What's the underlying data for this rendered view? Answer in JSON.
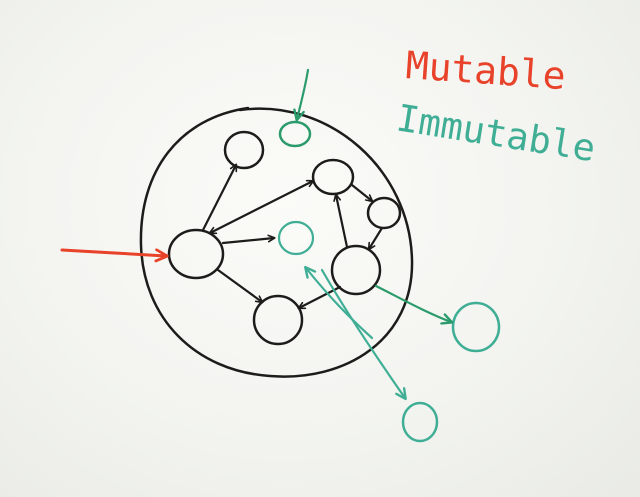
{
  "legend": {
    "mutable": {
      "label": "Mutable",
      "color": "#e8432a"
    },
    "immutable": {
      "label": "Immutable",
      "color": "#3fae95"
    }
  },
  "colors": {
    "ink": "#1e1c1a",
    "mutable": "#e8432a",
    "immutable": "#3fae95",
    "immutable_dark": "#2c9b6c"
  }
}
